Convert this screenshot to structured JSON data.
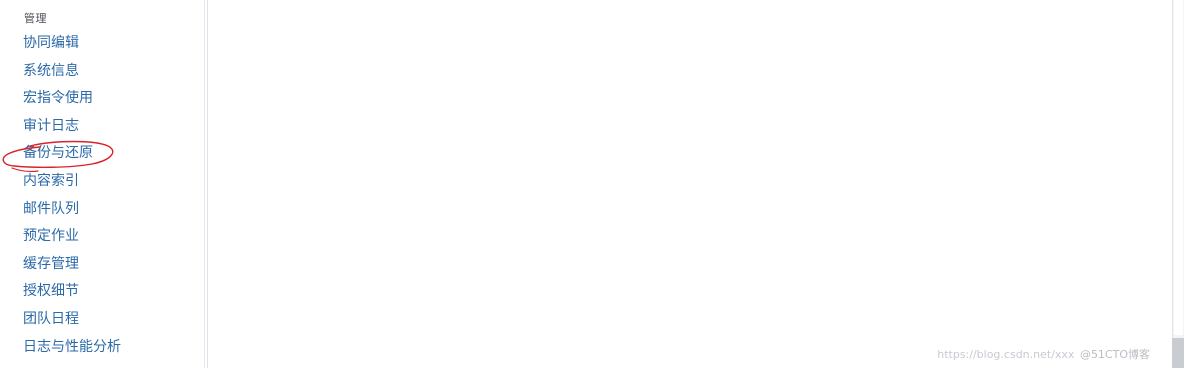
{
  "sidebar": {
    "heading": "管理",
    "items": [
      {
        "label": "协同编辑"
      },
      {
        "label": "系统信息"
      },
      {
        "label": "宏指令使用"
      },
      {
        "label": "审计日志"
      },
      {
        "label": "备份与还原"
      },
      {
        "label": "内容索引"
      },
      {
        "label": "邮件队列"
      },
      {
        "label": "预定作业"
      },
      {
        "label": "缓存管理"
      },
      {
        "label": "授权细节"
      },
      {
        "label": "团队日程"
      },
      {
        "label": "日志与性能分析"
      }
    ]
  },
  "watermark": {
    "url": "https://blog.csdn.net/xxx",
    "brand": "@51CTO博客"
  },
  "colors": {
    "link": "#2b6aa8",
    "annotation": "#d8232a"
  }
}
